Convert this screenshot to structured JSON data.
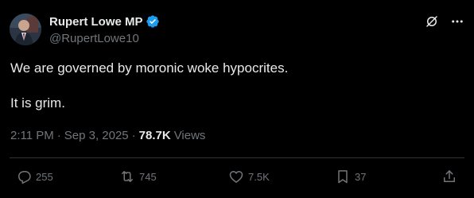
{
  "author": {
    "display_name": "Rupert Lowe MP",
    "handle": "@RupertLowe10",
    "verified": true
  },
  "post": {
    "paragraphs": [
      "We are governed by moronic woke hypocrites.",
      "It is grim."
    ]
  },
  "meta": {
    "time": "2:11 PM",
    "separator": "·",
    "date": "Sep 3, 2025",
    "views_count": "78.7K",
    "views_label": "Views"
  },
  "actions": {
    "replies": "255",
    "reposts": "745",
    "likes": "7.5K",
    "bookmarks": "37"
  },
  "colors": {
    "background": "#000000",
    "text_primary": "#e7e9ea",
    "text_secondary": "#71767b",
    "verified": "#1d9bf0",
    "divider": "#2f3336"
  },
  "icons": {
    "verified": "verified-badge-icon",
    "grok": "grok-icon",
    "more": "more-options-icon",
    "reply": "reply-icon",
    "repost": "repost-icon",
    "like": "heart-icon",
    "bookmark": "bookmark-icon",
    "share": "share-icon"
  }
}
